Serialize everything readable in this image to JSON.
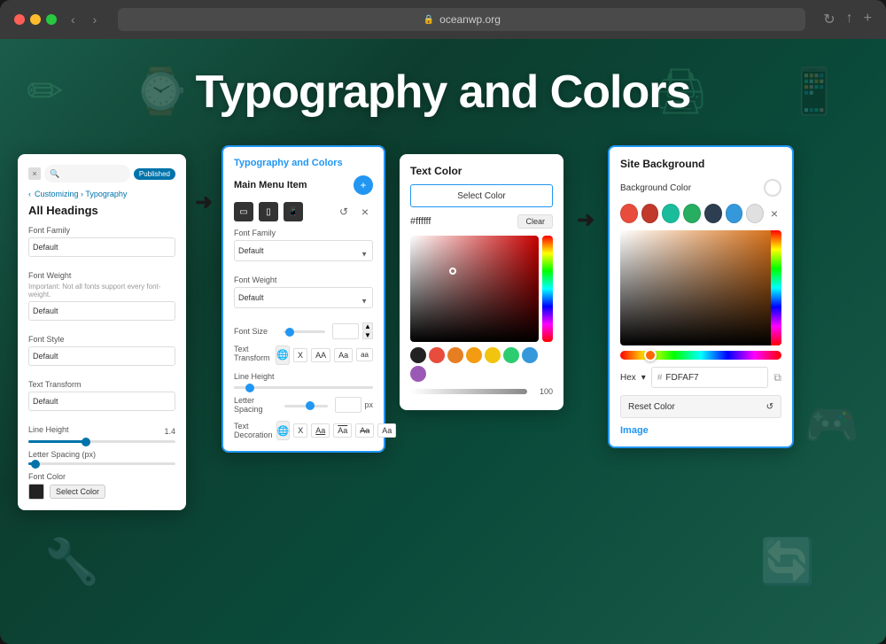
{
  "browser": {
    "url": "oceanwp.org",
    "back_btn": "‹",
    "forward_btn": "›",
    "reload_icon": "↻",
    "share_icon": "↑",
    "new_tab_icon": "+"
  },
  "hero": {
    "title": "Typography and Colors"
  },
  "panel_customizer": {
    "close_label": "×",
    "search_placeholder": "Search",
    "published_label": "Published",
    "breadcrumb": "Customizing › Typography",
    "section_title": "All Headings",
    "font_family_label": "Font Family",
    "font_family_value": "Default",
    "font_weight_label": "Font Weight",
    "font_weight_note": "Important: Not all fonts support every font-weight.",
    "font_weight_value": "Default",
    "font_style_label": "Font Style",
    "font_style_value": "Default",
    "text_transform_label": "Text Transform",
    "text_transform_value": "Default",
    "line_height_label": "Line Height",
    "line_height_value": "1.4",
    "letter_spacing_label": "Letter Spacing (px)",
    "font_color_label": "Font Color",
    "select_color_label": "Select Color"
  },
  "panel_typo": {
    "title": "Typography and Colors",
    "menu_label": "Main Menu Item",
    "plus_label": "+",
    "font_family_label": "Font Family",
    "font_family_value": "Default",
    "font_weight_label": "Font Weight",
    "font_weight_value": "Default",
    "font_size_label": "Font Size",
    "text_transform_label": "Text Transform",
    "transform_options": [
      "X",
      "AA",
      "Aa",
      "aa"
    ],
    "line_height_label": "Line Height",
    "letter_spacing_label": "Letter Spacing",
    "px_label": "px",
    "text_decoration_label": "Text Decoration",
    "decoration_options": [
      "X",
      "Aa",
      "Aa",
      "Aa",
      "Aa"
    ]
  },
  "panel_text_color": {
    "title": "Text Color",
    "select_color_label": "Select Color",
    "hex_value": "#ffffff",
    "clear_label": "Clear",
    "swatches": [
      "#222222",
      "#e74c3c",
      "#e67e22",
      "#f39c12",
      "#f1c40f",
      "#2ecc71",
      "#3498db",
      "#9b59b6"
    ],
    "opacity_value": "100"
  },
  "panel_site_bg": {
    "title": "Site Background",
    "bg_color_label": "Background Color",
    "close_label": "×",
    "swatches": [
      "#e74c3c",
      "#c0392b",
      "#1abc9c",
      "#16a085",
      "#2ecc71",
      "#1a535c",
      "#e0e0e0"
    ],
    "hex_label": "Hex",
    "hex_value": "FDFAF7",
    "copy_icon": "⧉",
    "reset_label": "Reset Color",
    "image_label": "Image"
  },
  "arrows": {
    "symbol": "➜"
  }
}
